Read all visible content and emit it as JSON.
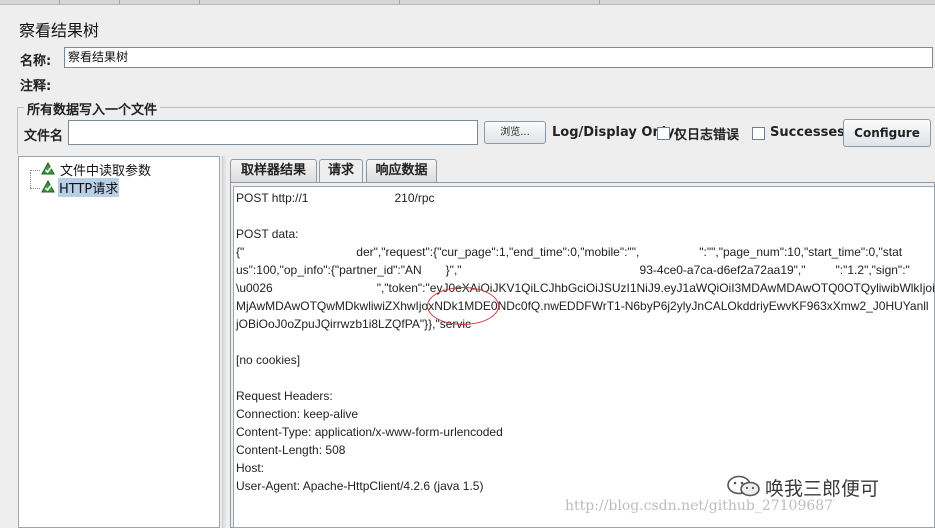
{
  "window": {
    "title": "察看结果树"
  },
  "fields": {
    "name_label": "名称:",
    "name_value": "察看结果树",
    "comment_label": "注释:",
    "comment_value": ""
  },
  "file_group": {
    "title": "所有数据写入一个文件",
    "filename_label": "文件名",
    "filename_value": "",
    "browse_button": "浏览...",
    "log_display_label": "Log/Display Only:",
    "errors_only_label": "仅日志错误",
    "errors_only_checked": false,
    "successes_label": "Successes",
    "successes_checked": false,
    "configure_button": "Configure"
  },
  "tree": {
    "items": [
      {
        "label": "文件中读取参数",
        "icon": "sampler-icon",
        "selected": false
      },
      {
        "label": "HTTP请求",
        "icon": "sampler-icon",
        "selected": true
      }
    ]
  },
  "tabs": [
    {
      "label": "取样器结果",
      "active": false
    },
    {
      "label": "请求",
      "active": true
    },
    {
      "label": "响应数据",
      "active": false
    }
  ],
  "request": {
    "line1_prefix": "POST http://1",
    "line1_suffix": "210/rpc",
    "post_data_label": "POST data:",
    "data_line1_a": "{\"",
    "data_line1_b": "der\",\"request\":{\"cur_page\":1,\"end_time\":0,\"mobile\":\"\",",
    "data_line1_c": "\":\"\",\"page_num\":10,\"start_time\":0,\"stat",
    "data_line2_a": "us\":100,\"op_info\":{\"partner_id\":\"AN",
    "data_line2_b": "}\",\"",
    "data_line2_c": "93-4ce0-a7ca-d6ef2a72aa19\",\"",
    "data_line2_d": "\":\"1.2\",\"sign\":\"",
    "data_line3_a": "\\u0026",
    "data_line3_b": "\",\"token\":\"eyJ0eXAiOiJKV1QiLCJhbGciOiJSUzI1NiJ9.eyJ1aWQiOiI3MDAwMDAwOTQ0OTQyliwibWlkIjoi",
    "data_line4": "MjAwMDAwOTQwMDkwliwiZXhwIjoxNDk1MDE0NDc0fQ.nwEDDFWrT1-N6byP6j2ylyJnCALOkddriyEwvKF963xXmw2_J0HUYanll",
    "data_line5_a": "jOBiOoJ0oZpuJQirrwzb1i8LZQfPA\"}},\"servic",
    "cookies": "[no cookies]",
    "headers_label": "Request Headers:",
    "header_connection": "Connection: keep-alive",
    "header_content_type": "Content-Type: application/x-www-form-urlencoded",
    "header_content_length": "Content-Length: 508",
    "header_host": "Host: ",
    "header_user_agent": "User-Agent: Apache-HttpClient/4.2.6 (java 1.5)"
  },
  "watermark": {
    "text": "唤我三郎便可",
    "url": "http://blog.csdn.net/github_27109687"
  },
  "colors": {
    "background": "#eeeeee",
    "selection": "#b8cfe5",
    "annotation_circle": "#d23a3a"
  }
}
